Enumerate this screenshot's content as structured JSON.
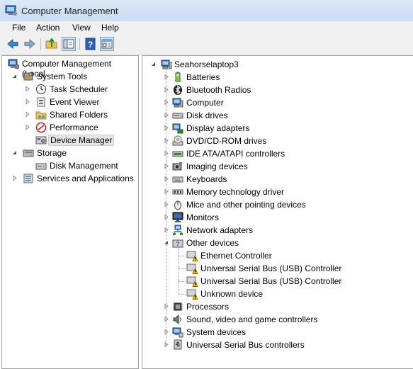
{
  "window": {
    "title": "Computer Management"
  },
  "menu": [
    "File",
    "Action",
    "View",
    "Help"
  ],
  "toolbar": {
    "buttons": [
      "back",
      "forward",
      "up",
      "show-hide-tree",
      "help",
      "properties"
    ]
  },
  "left_tree": [
    {
      "label": "Computer Management (Local",
      "level": 0,
      "icon": "computer-management-icon",
      "expander": "none"
    },
    {
      "label": "System Tools",
      "level": 1,
      "icon": "system-tools-icon",
      "expander": "expanded"
    },
    {
      "label": "Task Scheduler",
      "level": 2,
      "icon": "clock-icon",
      "expander": "collapsed"
    },
    {
      "label": "Event Viewer",
      "level": 2,
      "icon": "event-viewer-icon",
      "expander": "collapsed"
    },
    {
      "label": "Shared Folders",
      "level": 2,
      "icon": "shared-folders-icon",
      "expander": "collapsed"
    },
    {
      "label": "Performance",
      "level": 2,
      "icon": "performance-icon",
      "expander": "collapsed"
    },
    {
      "label": "Device Manager",
      "level": 2,
      "icon": "device-manager-icon",
      "expander": "none",
      "selected": true
    },
    {
      "label": "Storage",
      "level": 1,
      "icon": "storage-icon",
      "expander": "expanded"
    },
    {
      "label": "Disk Management",
      "level": 2,
      "icon": "disk-management-icon",
      "expander": "none"
    },
    {
      "label": "Services and Applications",
      "level": 1,
      "icon": "services-icon",
      "expander": "collapsed"
    }
  ],
  "device_tree": {
    "root": {
      "label": "Seahorselaptop3",
      "icon": "computer-icon"
    },
    "categories": [
      {
        "label": "Batteries",
        "icon": "battery-icon",
        "expander": "collapsed"
      },
      {
        "label": "Bluetooth Radios",
        "icon": "bluetooth-icon",
        "expander": "collapsed"
      },
      {
        "label": "Computer",
        "icon": "computer-icon",
        "expander": "collapsed"
      },
      {
        "label": "Disk drives",
        "icon": "disk-drive-icon",
        "expander": "collapsed"
      },
      {
        "label": "Display adapters",
        "icon": "display-adapter-icon",
        "expander": "collapsed"
      },
      {
        "label": "DVD/CD-ROM drives",
        "icon": "dvd-icon",
        "expander": "collapsed"
      },
      {
        "label": "IDE ATA/ATAPI controllers",
        "icon": "ide-controller-icon",
        "expander": "collapsed"
      },
      {
        "label": "Imaging devices",
        "icon": "camera-icon",
        "expander": "collapsed"
      },
      {
        "label": "Keyboards",
        "icon": "keyboard-icon",
        "expander": "collapsed"
      },
      {
        "label": "Memory technology driver",
        "icon": "memory-icon",
        "expander": "collapsed"
      },
      {
        "label": "Mice and other pointing devices",
        "icon": "mouse-icon",
        "expander": "collapsed"
      },
      {
        "label": "Monitors",
        "icon": "monitor-icon",
        "expander": "collapsed"
      },
      {
        "label": "Network adapters",
        "icon": "network-icon",
        "expander": "collapsed"
      },
      {
        "label": "Other devices",
        "icon": "unknown-device-icon",
        "expander": "expanded",
        "children": [
          {
            "label": "Ethernet Controller",
            "icon": "warning-device-icon"
          },
          {
            "label": "Universal Serial Bus (USB) Controller",
            "icon": "warning-device-icon"
          },
          {
            "label": "Universal Serial Bus (USB) Controller",
            "icon": "warning-device-icon"
          },
          {
            "label": "Unknown device",
            "icon": "warning-device-icon"
          }
        ]
      },
      {
        "label": "Processors",
        "icon": "processor-icon",
        "expander": "collapsed"
      },
      {
        "label": "Sound, video and game controllers",
        "icon": "speaker-icon",
        "expander": "collapsed"
      },
      {
        "label": "System devices",
        "icon": "system-device-icon",
        "expander": "collapsed"
      },
      {
        "label": "Universal Serial Bus controllers",
        "icon": "usb-icon",
        "expander": "collapsed"
      }
    ]
  },
  "colors": {
    "title_bar": "#d3e2f3",
    "selection": "#e5e5e5",
    "warning": "#f5c400",
    "window_bg": "#f0f0f0"
  }
}
